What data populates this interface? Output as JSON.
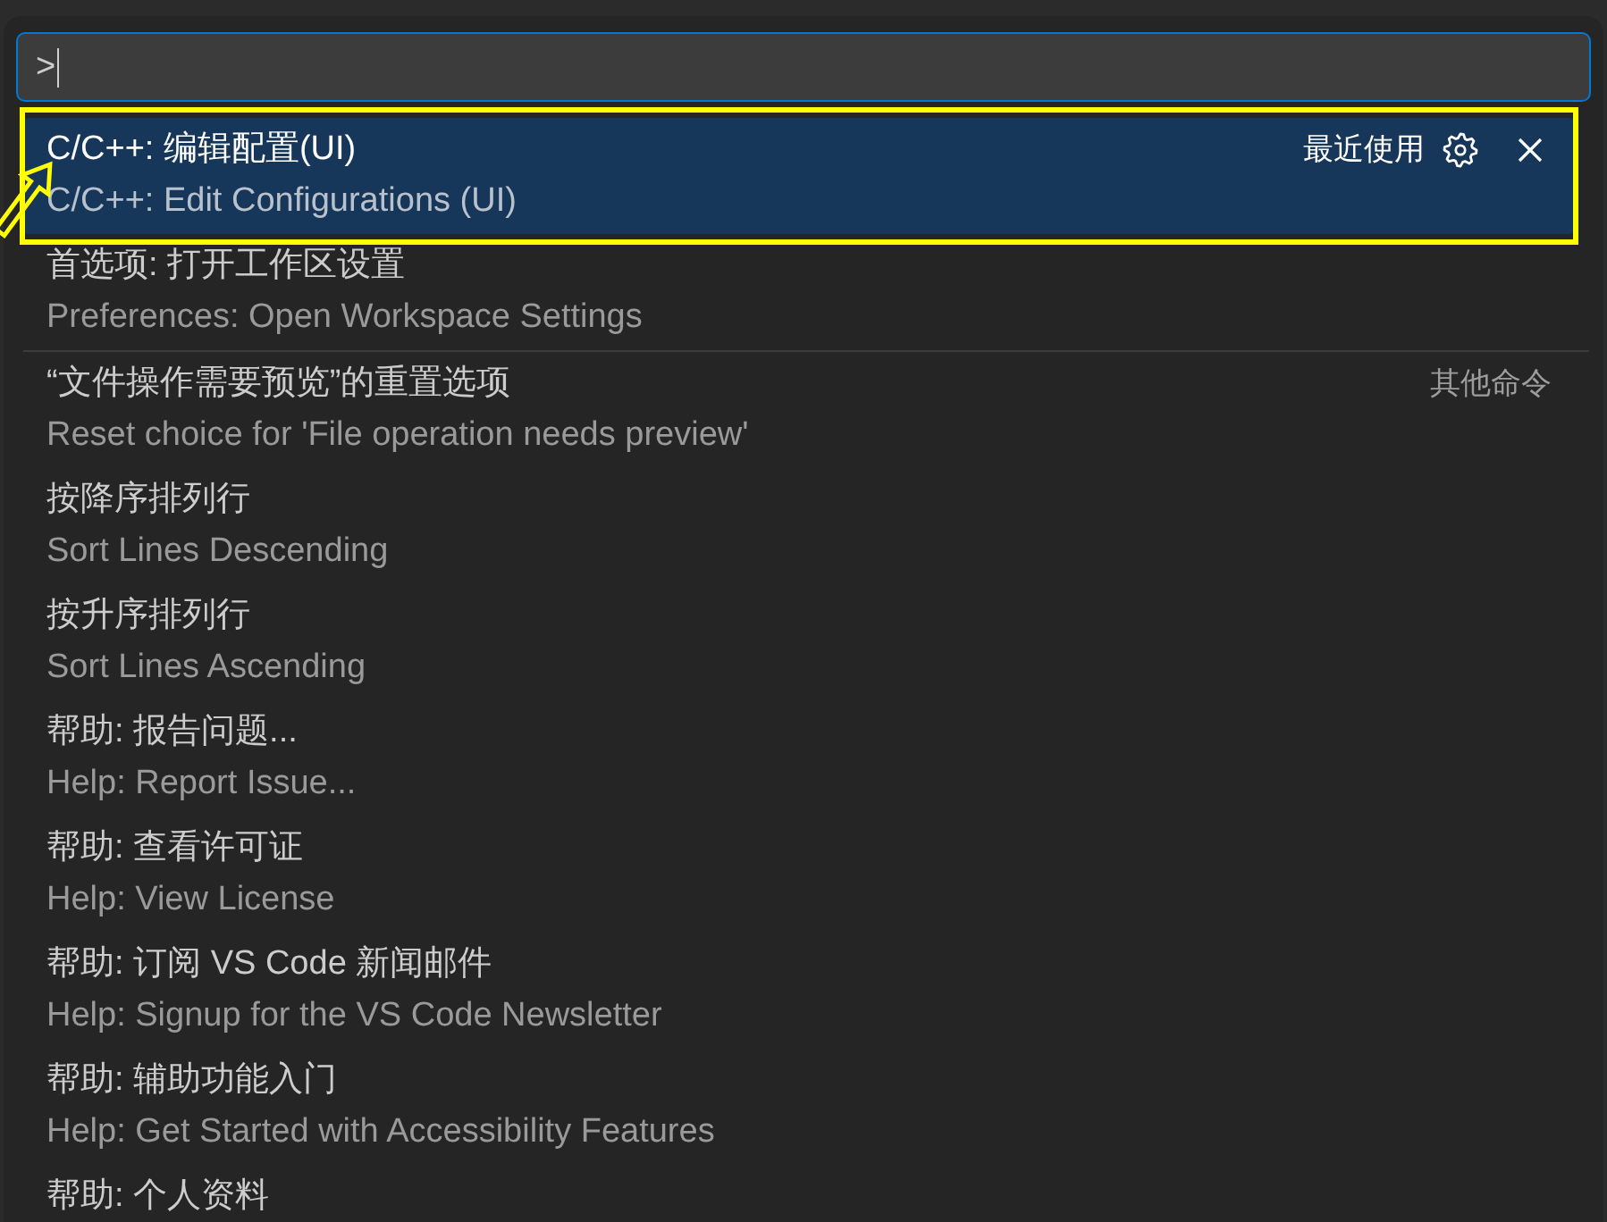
{
  "input": {
    "value": ">"
  },
  "groups": [
    {
      "label": "最近使用",
      "commands": [
        {
          "title": "C/C++: 编辑配置(UI)",
          "detail": "C/C++: Edit Configurations (UI)",
          "selected": true,
          "highlighted": true
        },
        {
          "title": "首选项: 打开工作区设置",
          "detail": "Preferences: Open Workspace Settings",
          "selected": false,
          "highlighted": false
        }
      ]
    },
    {
      "label": "其他命令",
      "commands": [
        {
          "title": "“文件操作需要预览”的重置选项",
          "detail": "Reset choice for 'File operation needs preview'",
          "selected": false,
          "highlighted": false
        },
        {
          "title": "按降序排列行",
          "detail": "Sort Lines Descending",
          "selected": false,
          "highlighted": false
        },
        {
          "title": "按升序排列行",
          "detail": "Sort Lines Ascending",
          "selected": false,
          "highlighted": false
        },
        {
          "title": "帮助: 报告问题...",
          "detail": "Help: Report Issue...",
          "selected": false,
          "highlighted": false
        },
        {
          "title": "帮助: 查看许可证",
          "detail": "Help: View License",
          "selected": false,
          "highlighted": false
        },
        {
          "title": "帮助: 订阅 VS Code 新闻邮件",
          "detail": "Help: Signup for the VS Code Newsletter",
          "selected": false,
          "highlighted": false
        },
        {
          "title": "帮助: 辅助功能入门",
          "detail": "Help: Get Started with Accessibility Features",
          "selected": false,
          "highlighted": false
        },
        {
          "title": "帮助: 个人资料",
          "selected": false,
          "highlighted": false
        }
      ]
    }
  ]
}
